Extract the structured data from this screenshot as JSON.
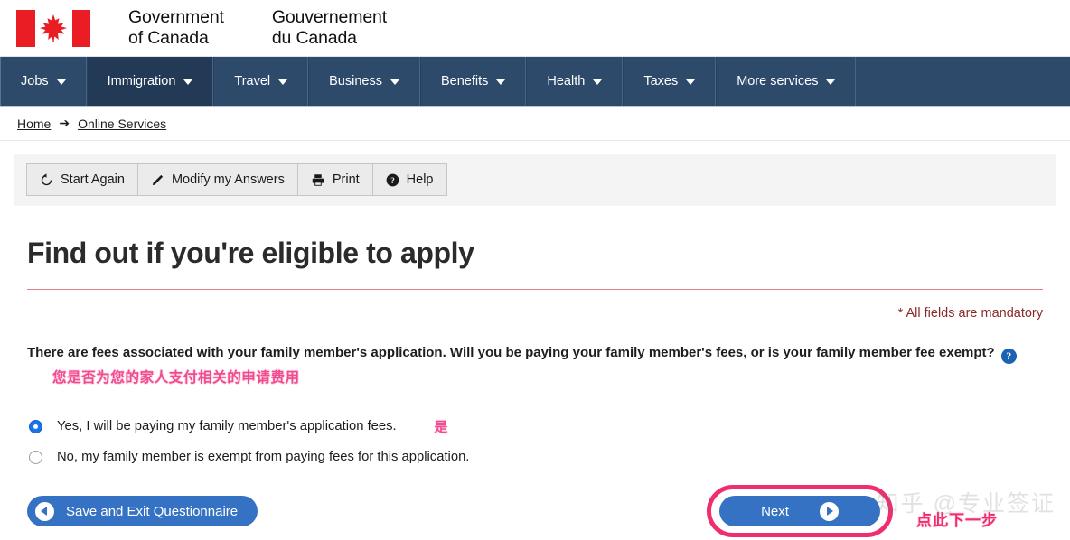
{
  "header": {
    "title_en": "Government\nof Canada",
    "title_en_line1": "Government",
    "title_en_line2": "of Canada",
    "title_fr_line1": "Gouvernement",
    "title_fr_line2": "du Canada",
    "flag_color": "#ea1d25"
  },
  "nav": {
    "background": "#2d4a6b",
    "active_background": "#223a56",
    "items": [
      {
        "label": "Jobs",
        "active": false
      },
      {
        "label": "Immigration",
        "active": true
      },
      {
        "label": "Travel",
        "active": false
      },
      {
        "label": "Business",
        "active": false
      },
      {
        "label": "Benefits",
        "active": false
      },
      {
        "label": "Health",
        "active": false
      },
      {
        "label": "Taxes",
        "active": false
      },
      {
        "label": "More services",
        "active": false
      }
    ]
  },
  "breadcrumb": {
    "home": "Home",
    "arrow": "➔",
    "current": "Online Services"
  },
  "toolbar": {
    "start_again": "Start Again",
    "modify": "Modify my Answers",
    "print": "Print",
    "help": "Help"
  },
  "main": {
    "page_title": "Find out if you're eligible to apply",
    "mandatory_note": "* All fields are mandatory",
    "question_part1": "There are fees associated with your ",
    "question_link": "family member",
    "question_part2": "'s application. Will you be paying your family member's fees, or is your family member fee exempt?",
    "help_glyph": "?",
    "annotation_question": "您是否为您的家人支付相关的申请费用",
    "annotation_color": "#ef4b8f",
    "options": [
      {
        "label": "Yes, I will be paying my family member's application fees.",
        "checked": true,
        "annotation": "是"
      },
      {
        "label": "No, my family member is exempt from paying fees for this application.",
        "checked": false,
        "annotation": ""
      }
    ]
  },
  "footer": {
    "save_exit": "Save and Exit Questionnaire",
    "next": "Next",
    "next_annotation": "点此下一步",
    "highlight_color": "#ef2d6f",
    "button_color": "#3672c4"
  },
  "watermark": {
    "text": "知乎 @专业签证"
  }
}
